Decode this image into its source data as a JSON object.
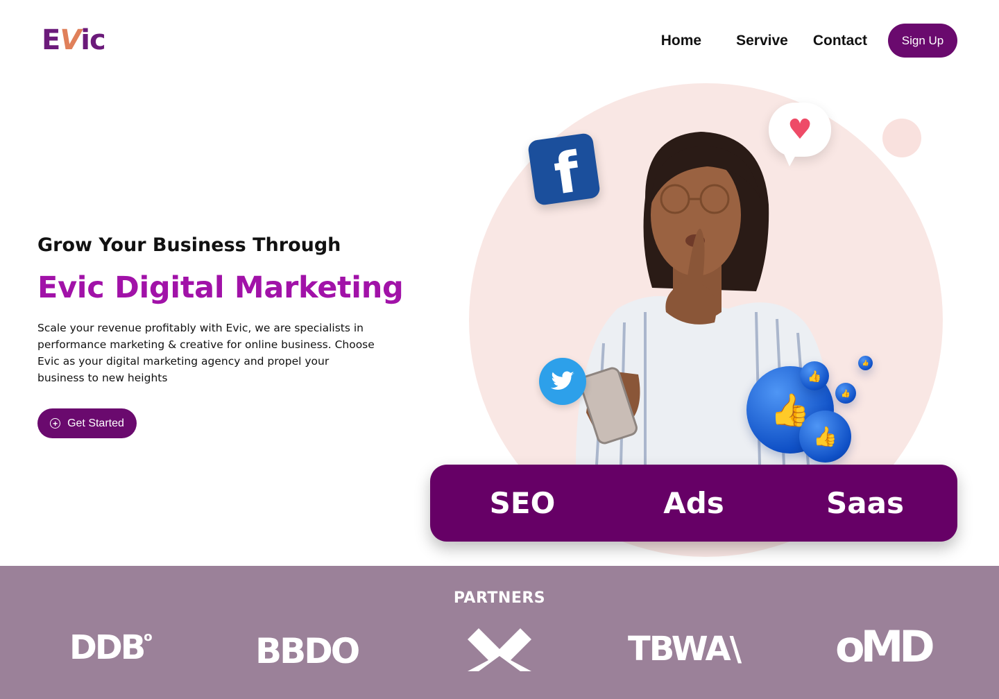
{
  "brand": {
    "logo_e": "E",
    "logo_v": "V",
    "logo_ic": "ic",
    "primary_color": "#6a0a6e",
    "accent_color": "#a112a8"
  },
  "nav": {
    "home": "Home",
    "service": "Servive",
    "contact": "Contact",
    "signup": "Sign Up"
  },
  "hero": {
    "subtitle": "Grow Your Business Through",
    "title": "Evic Digital Marketing",
    "description": "Scale your revenue profitably with Evic, we are specialists in performance marketing & creative for online business. Choose Evic as your digital marketing agency and propel your business to new heights",
    "cta_label": "Get Started",
    "cta_icon": "plus-circle-icon"
  },
  "social_icons": {
    "facebook": "f",
    "heart": "♥",
    "twitter": "🐦",
    "like": "👍"
  },
  "services": [
    {
      "label": "SEO"
    },
    {
      "label": "Ads"
    },
    {
      "label": "Saas"
    }
  ],
  "partners": {
    "title": "PARTNERS",
    "logos": [
      "DDB",
      "BBDO",
      "TBWA\\",
      "oMD"
    ]
  }
}
